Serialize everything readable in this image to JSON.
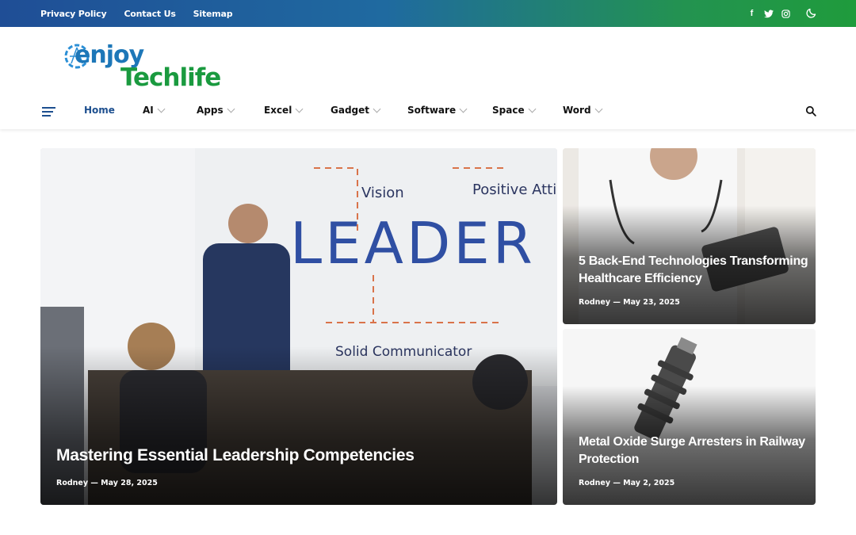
{
  "topbar": {
    "links": [
      "Privacy Policy",
      "Contact Us",
      "Sitemap"
    ],
    "social_icons": [
      "facebook-icon",
      "twitter-icon",
      "instagram-icon"
    ],
    "theme_toggle_icon": "moon-icon",
    "gradient_colors": [
      "#1f4e96",
      "#1f9b3c"
    ]
  },
  "logo": {
    "line1": "enjoy",
    "line2": "Techlife",
    "colors": {
      "enjoy": "#1d77b8",
      "techlife": "#1a9a3f"
    }
  },
  "nav": {
    "items": [
      {
        "label": "Home",
        "active": true
      },
      {
        "label": "AI",
        "dropdown": true
      },
      {
        "label": "Apps",
        "dropdown": true
      },
      {
        "label": "Excel",
        "dropdown": true
      },
      {
        "label": "Gadget",
        "dropdown": true
      },
      {
        "label": "Software",
        "dropdown": true
      },
      {
        "label": "Space",
        "dropdown": true
      },
      {
        "label": "Word",
        "dropdown": true
      }
    ],
    "accent": "#1d4f8f"
  },
  "featured": {
    "main": {
      "title": "Mastering Essential Leadership Competencies",
      "author": "Rodney",
      "date": "May 28, 2025"
    },
    "side": [
      {
        "title": "5 Back-End Technologies Transforming Healthcare Efficiency",
        "author": "Rodney",
        "date": "May 23, 2025"
      },
      {
        "title": "Metal Oxide Surge Arresters in Railway Protection",
        "author": "Rodney",
        "date": "May 2, 2025"
      }
    ]
  }
}
